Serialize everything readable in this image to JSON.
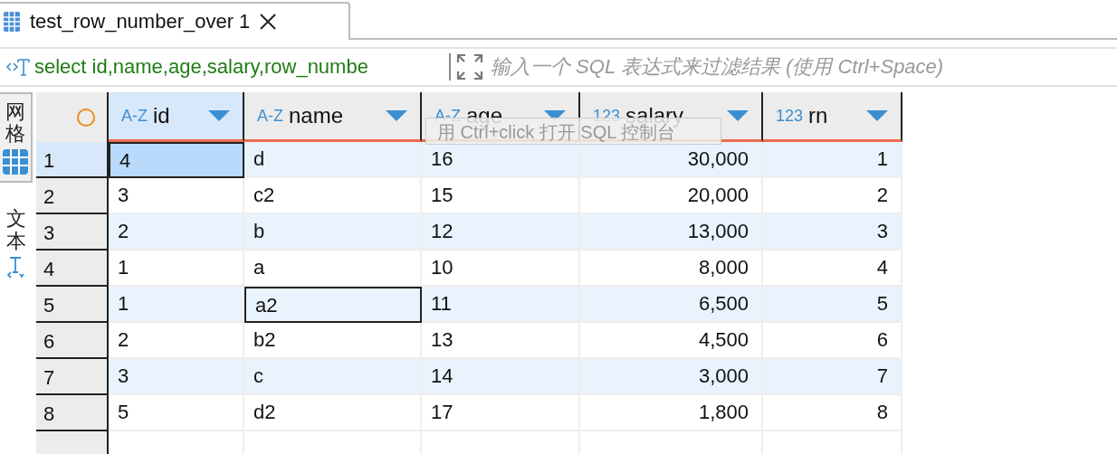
{
  "tab": {
    "title": "test_row_number_over 1"
  },
  "filter": {
    "query": "select id,name,age,salary,row_numbe",
    "placeholder": "输入一个 SQL 表达式来过滤结果 (使用 Ctrl+Space)"
  },
  "side_tabs": [
    {
      "label": "网格",
      "selected": true
    },
    {
      "label": "文本",
      "selected": false
    }
  ],
  "columns": [
    {
      "name": "id",
      "type": "A-Z",
      "selected": true
    },
    {
      "name": "name",
      "type": "A-Z",
      "selected": false
    },
    {
      "name": "age",
      "type": "A-Z",
      "selected": false
    },
    {
      "name": "salary",
      "type": "123",
      "selected": false
    },
    {
      "name": "rn",
      "type": "123",
      "selected": false
    }
  ],
  "rows": [
    {
      "number": "1",
      "selected": true,
      "cells": [
        {
          "text": "4",
          "selected": true
        },
        {
          "text": "d",
          "selected": false
        },
        {
          "text": "16",
          "selected": false
        },
        {
          "text": "30,000",
          "selected": false
        },
        {
          "text": "1",
          "selected": false
        }
      ]
    },
    {
      "number": "2",
      "selected": false,
      "cells": [
        {
          "text": "3",
          "selected": false
        },
        {
          "text": "c2",
          "selected": false
        },
        {
          "text": "15",
          "selected": false
        },
        {
          "text": "20,000",
          "selected": false
        },
        {
          "text": "2",
          "selected": false
        }
      ]
    },
    {
      "number": "3",
      "selected": false,
      "cells": [
        {
          "text": "2",
          "selected": false
        },
        {
          "text": "b",
          "selected": false
        },
        {
          "text": "12",
          "selected": false
        },
        {
          "text": "13,000",
          "selected": false
        },
        {
          "text": "3",
          "selected": false
        }
      ]
    },
    {
      "number": "4",
      "selected": false,
      "cells": [
        {
          "text": "1",
          "selected": false
        },
        {
          "text": "a",
          "selected": false
        },
        {
          "text": "10",
          "selected": false
        },
        {
          "text": "8,000",
          "selected": false
        },
        {
          "text": "4",
          "selected": false
        }
      ]
    },
    {
      "number": "5",
      "selected": false,
      "cells": [
        {
          "text": "1",
          "selected": false
        },
        {
          "text": "a2",
          "selected": true
        },
        {
          "text": "11",
          "selected": false
        },
        {
          "text": "6,500",
          "selected": false
        },
        {
          "text": "5",
          "selected": false
        }
      ]
    },
    {
      "number": "6",
      "selected": false,
      "cells": [
        {
          "text": "2",
          "selected": false
        },
        {
          "text": "b2",
          "selected": false
        },
        {
          "text": "13",
          "selected": false
        },
        {
          "text": "4,500",
          "selected": false
        },
        {
          "text": "6",
          "selected": false
        }
      ]
    },
    {
      "number": "7",
      "selected": false,
      "cells": [
        {
          "text": "3",
          "selected": false
        },
        {
          "text": "c",
          "selected": false
        },
        {
          "text": "14",
          "selected": false
        },
        {
          "text": "3,000",
          "selected": false
        },
        {
          "text": "7",
          "selected": false
        }
      ]
    },
    {
      "number": "8",
      "selected": false,
      "cells": [
        {
          "text": "5",
          "selected": false
        },
        {
          "text": "d2",
          "selected": false
        },
        {
          "text": "17",
          "selected": false
        },
        {
          "text": "1,800",
          "selected": false
        },
        {
          "text": "8",
          "selected": false
        }
      ]
    }
  ],
  "tooltip": {
    "text": "用 Ctrl+click 打开 SQL 控制台"
  }
}
